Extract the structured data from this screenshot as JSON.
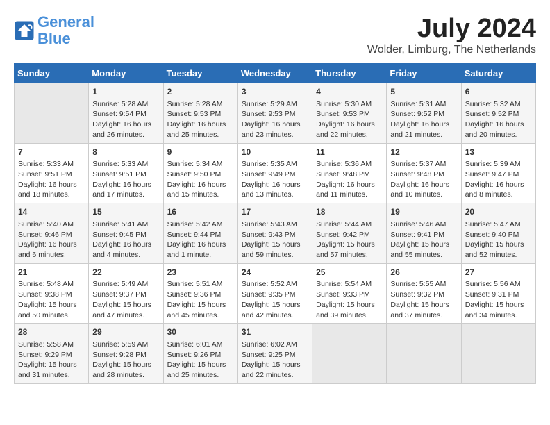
{
  "header": {
    "logo_line1": "General",
    "logo_line2": "Blue",
    "month_year": "July 2024",
    "location": "Wolder, Limburg, The Netherlands"
  },
  "days_of_week": [
    "Sunday",
    "Monday",
    "Tuesday",
    "Wednesday",
    "Thursday",
    "Friday",
    "Saturday"
  ],
  "weeks": [
    [
      {
        "day": "",
        "content": ""
      },
      {
        "day": "1",
        "content": "Sunrise: 5:28 AM\nSunset: 9:54 PM\nDaylight: 16 hours\nand 26 minutes."
      },
      {
        "day": "2",
        "content": "Sunrise: 5:28 AM\nSunset: 9:53 PM\nDaylight: 16 hours\nand 25 minutes."
      },
      {
        "day": "3",
        "content": "Sunrise: 5:29 AM\nSunset: 9:53 PM\nDaylight: 16 hours\nand 23 minutes."
      },
      {
        "day": "4",
        "content": "Sunrise: 5:30 AM\nSunset: 9:53 PM\nDaylight: 16 hours\nand 22 minutes."
      },
      {
        "day": "5",
        "content": "Sunrise: 5:31 AM\nSunset: 9:52 PM\nDaylight: 16 hours\nand 21 minutes."
      },
      {
        "day": "6",
        "content": "Sunrise: 5:32 AM\nSunset: 9:52 PM\nDaylight: 16 hours\nand 20 minutes."
      }
    ],
    [
      {
        "day": "7",
        "content": "Sunrise: 5:33 AM\nSunset: 9:51 PM\nDaylight: 16 hours\nand 18 minutes."
      },
      {
        "day": "8",
        "content": "Sunrise: 5:33 AM\nSunset: 9:51 PM\nDaylight: 16 hours\nand 17 minutes."
      },
      {
        "day": "9",
        "content": "Sunrise: 5:34 AM\nSunset: 9:50 PM\nDaylight: 16 hours\nand 15 minutes."
      },
      {
        "day": "10",
        "content": "Sunrise: 5:35 AM\nSunset: 9:49 PM\nDaylight: 16 hours\nand 13 minutes."
      },
      {
        "day": "11",
        "content": "Sunrise: 5:36 AM\nSunset: 9:48 PM\nDaylight: 16 hours\nand 11 minutes."
      },
      {
        "day": "12",
        "content": "Sunrise: 5:37 AM\nSunset: 9:48 PM\nDaylight: 16 hours\nand 10 minutes."
      },
      {
        "day": "13",
        "content": "Sunrise: 5:39 AM\nSunset: 9:47 PM\nDaylight: 16 hours\nand 8 minutes."
      }
    ],
    [
      {
        "day": "14",
        "content": "Sunrise: 5:40 AM\nSunset: 9:46 PM\nDaylight: 16 hours\nand 6 minutes."
      },
      {
        "day": "15",
        "content": "Sunrise: 5:41 AM\nSunset: 9:45 PM\nDaylight: 16 hours\nand 4 minutes."
      },
      {
        "day": "16",
        "content": "Sunrise: 5:42 AM\nSunset: 9:44 PM\nDaylight: 16 hours\nand 1 minute."
      },
      {
        "day": "17",
        "content": "Sunrise: 5:43 AM\nSunset: 9:43 PM\nDaylight: 15 hours\nand 59 minutes."
      },
      {
        "day": "18",
        "content": "Sunrise: 5:44 AM\nSunset: 9:42 PM\nDaylight: 15 hours\nand 57 minutes."
      },
      {
        "day": "19",
        "content": "Sunrise: 5:46 AM\nSunset: 9:41 PM\nDaylight: 15 hours\nand 55 minutes."
      },
      {
        "day": "20",
        "content": "Sunrise: 5:47 AM\nSunset: 9:40 PM\nDaylight: 15 hours\nand 52 minutes."
      }
    ],
    [
      {
        "day": "21",
        "content": "Sunrise: 5:48 AM\nSunset: 9:38 PM\nDaylight: 15 hours\nand 50 minutes."
      },
      {
        "day": "22",
        "content": "Sunrise: 5:49 AM\nSunset: 9:37 PM\nDaylight: 15 hours\nand 47 minutes."
      },
      {
        "day": "23",
        "content": "Sunrise: 5:51 AM\nSunset: 9:36 PM\nDaylight: 15 hours\nand 45 minutes."
      },
      {
        "day": "24",
        "content": "Sunrise: 5:52 AM\nSunset: 9:35 PM\nDaylight: 15 hours\nand 42 minutes."
      },
      {
        "day": "25",
        "content": "Sunrise: 5:54 AM\nSunset: 9:33 PM\nDaylight: 15 hours\nand 39 minutes."
      },
      {
        "day": "26",
        "content": "Sunrise: 5:55 AM\nSunset: 9:32 PM\nDaylight: 15 hours\nand 37 minutes."
      },
      {
        "day": "27",
        "content": "Sunrise: 5:56 AM\nSunset: 9:31 PM\nDaylight: 15 hours\nand 34 minutes."
      }
    ],
    [
      {
        "day": "28",
        "content": "Sunrise: 5:58 AM\nSunset: 9:29 PM\nDaylight: 15 hours\nand 31 minutes."
      },
      {
        "day": "29",
        "content": "Sunrise: 5:59 AM\nSunset: 9:28 PM\nDaylight: 15 hours\nand 28 minutes."
      },
      {
        "day": "30",
        "content": "Sunrise: 6:01 AM\nSunset: 9:26 PM\nDaylight: 15 hours\nand 25 minutes."
      },
      {
        "day": "31",
        "content": "Sunrise: 6:02 AM\nSunset: 9:25 PM\nDaylight: 15 hours\nand 22 minutes."
      },
      {
        "day": "",
        "content": ""
      },
      {
        "day": "",
        "content": ""
      },
      {
        "day": "",
        "content": ""
      }
    ]
  ]
}
